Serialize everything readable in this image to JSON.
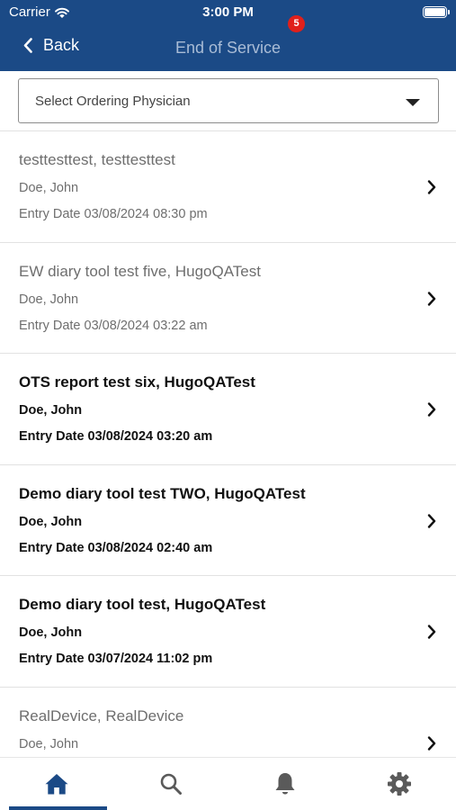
{
  "status_bar": {
    "carrier": "Carrier",
    "time": "3:00 PM"
  },
  "nav": {
    "back_label": "Back",
    "title": "End of Service"
  },
  "filter": {
    "placeholder": "Select Ordering Physician"
  },
  "entries": [
    {
      "title": "testtesttest, testtesttest",
      "physician": "Doe, John",
      "entry_date": "Entry Date 03/08/2024 08:30 pm",
      "read": true
    },
    {
      "title": "EW diary tool test five, HugoQATest",
      "physician": "Doe, John",
      "entry_date": "Entry Date 03/08/2024 03:22 am",
      "read": true
    },
    {
      "title": "OTS report test six, HugoQATest",
      "physician": "Doe, John",
      "entry_date": "Entry Date 03/08/2024 03:20 am",
      "read": false
    },
    {
      "title": "Demo diary tool test TWO, HugoQATest",
      "physician": "Doe, John",
      "entry_date": "Entry Date 03/08/2024 02:40 am",
      "read": false
    },
    {
      "title": "Demo diary tool test, HugoQATest",
      "physician": "Doe, John",
      "entry_date": "Entry Date 03/07/2024 11:02 pm",
      "read": false
    },
    {
      "title": "RealDevice, RealDevice",
      "physician": "Doe, John",
      "entry_date": "",
      "read": true
    }
  ],
  "tabbar": {
    "tabs": [
      "home-icon",
      "search-icon",
      "bell-icon",
      "gear-icon"
    ],
    "active": "home-icon",
    "notification_count": "5"
  },
  "colors": {
    "header": "#1b4a86",
    "badge": "#e0201b",
    "read_text": "#6e6e6e",
    "unread_text": "#111111"
  }
}
